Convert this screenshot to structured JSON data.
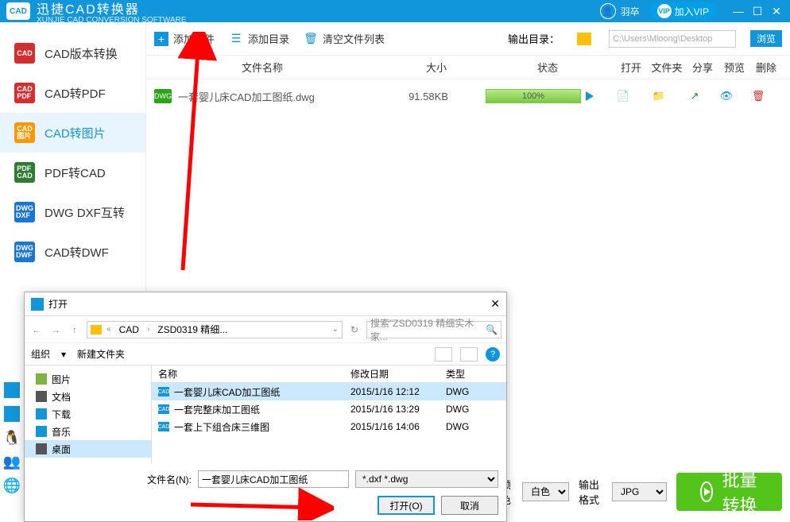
{
  "titlebar": {
    "app_name": "迅捷CAD转换器",
    "app_en": "XUNJIE CAD CONVERSION SOFTWARE",
    "logo_text": "CAD",
    "user_name": "羽卒",
    "vip_label": "加入VIP",
    "vip_badge": "VIP"
  },
  "sidebar": {
    "items": [
      {
        "label": "CAD版本转换",
        "color": "#d32f2f"
      },
      {
        "label": "CAD转PDF",
        "color": "#d32f2f"
      },
      {
        "label": "CAD转图片",
        "color": "#ff9800"
      },
      {
        "label": "PDF转CAD",
        "color": "#2e7d32"
      },
      {
        "label": "DWG DXF互转",
        "color": "#1976d2"
      },
      {
        "label": "CAD转DWF",
        "color": "#1976d2"
      }
    ]
  },
  "toolbar": {
    "add_file": "添加文件",
    "add_dir": "添加目录",
    "clear": "清空文件列表",
    "out_label": "输出目录：",
    "out_path": "C:\\Users\\Mloong\\Desktop",
    "browse": "浏览"
  },
  "table": {
    "headers": {
      "name": "文件名称",
      "size": "大小",
      "status": "状态",
      "open": "打开",
      "folder": "文件夹",
      "share": "分享",
      "preview": "预览",
      "delete": "删除"
    },
    "rows": [
      {
        "name": "一套婴儿床CAD加工图纸.dwg",
        "size": "91.58KB",
        "progress": "100%"
      }
    ]
  },
  "bottom": {
    "color_label": "颜色",
    "color_value": "白色",
    "format_label": "输出格式",
    "format_value": "JPG",
    "convert": "批量转换"
  },
  "dialog": {
    "title": "打开",
    "path": {
      "seg1": "CAD",
      "seg2": "ZSD0319 精细..."
    },
    "search_placeholder": "搜索\"ZSD0319 精细实木家...",
    "organize": "组织",
    "newfolder": "新建文件夹",
    "tree": [
      {
        "label": "图片"
      },
      {
        "label": "文档"
      },
      {
        "label": "下载"
      },
      {
        "label": "音乐"
      },
      {
        "label": "桌面"
      }
    ],
    "list_headers": {
      "name": "名称",
      "date": "修改日期",
      "type": "类型"
    },
    "list_rows": [
      {
        "name": "一套婴儿床CAD加工图纸",
        "date": "2015/1/16 12:12",
        "type": "DWG"
      },
      {
        "name": "一套完整床加工图纸",
        "date": "2015/1/16 13:29",
        "type": "DWG"
      },
      {
        "name": "一套上下组合床三维图",
        "date": "2015/1/16 14:06",
        "type": "DWG"
      }
    ],
    "filename_label": "文件名(N):",
    "filename_value": "一套婴儿床CAD加工图纸",
    "filter": "*.dxf *.dwg",
    "open_btn": "打开(O)",
    "cancel_btn": "取消"
  }
}
